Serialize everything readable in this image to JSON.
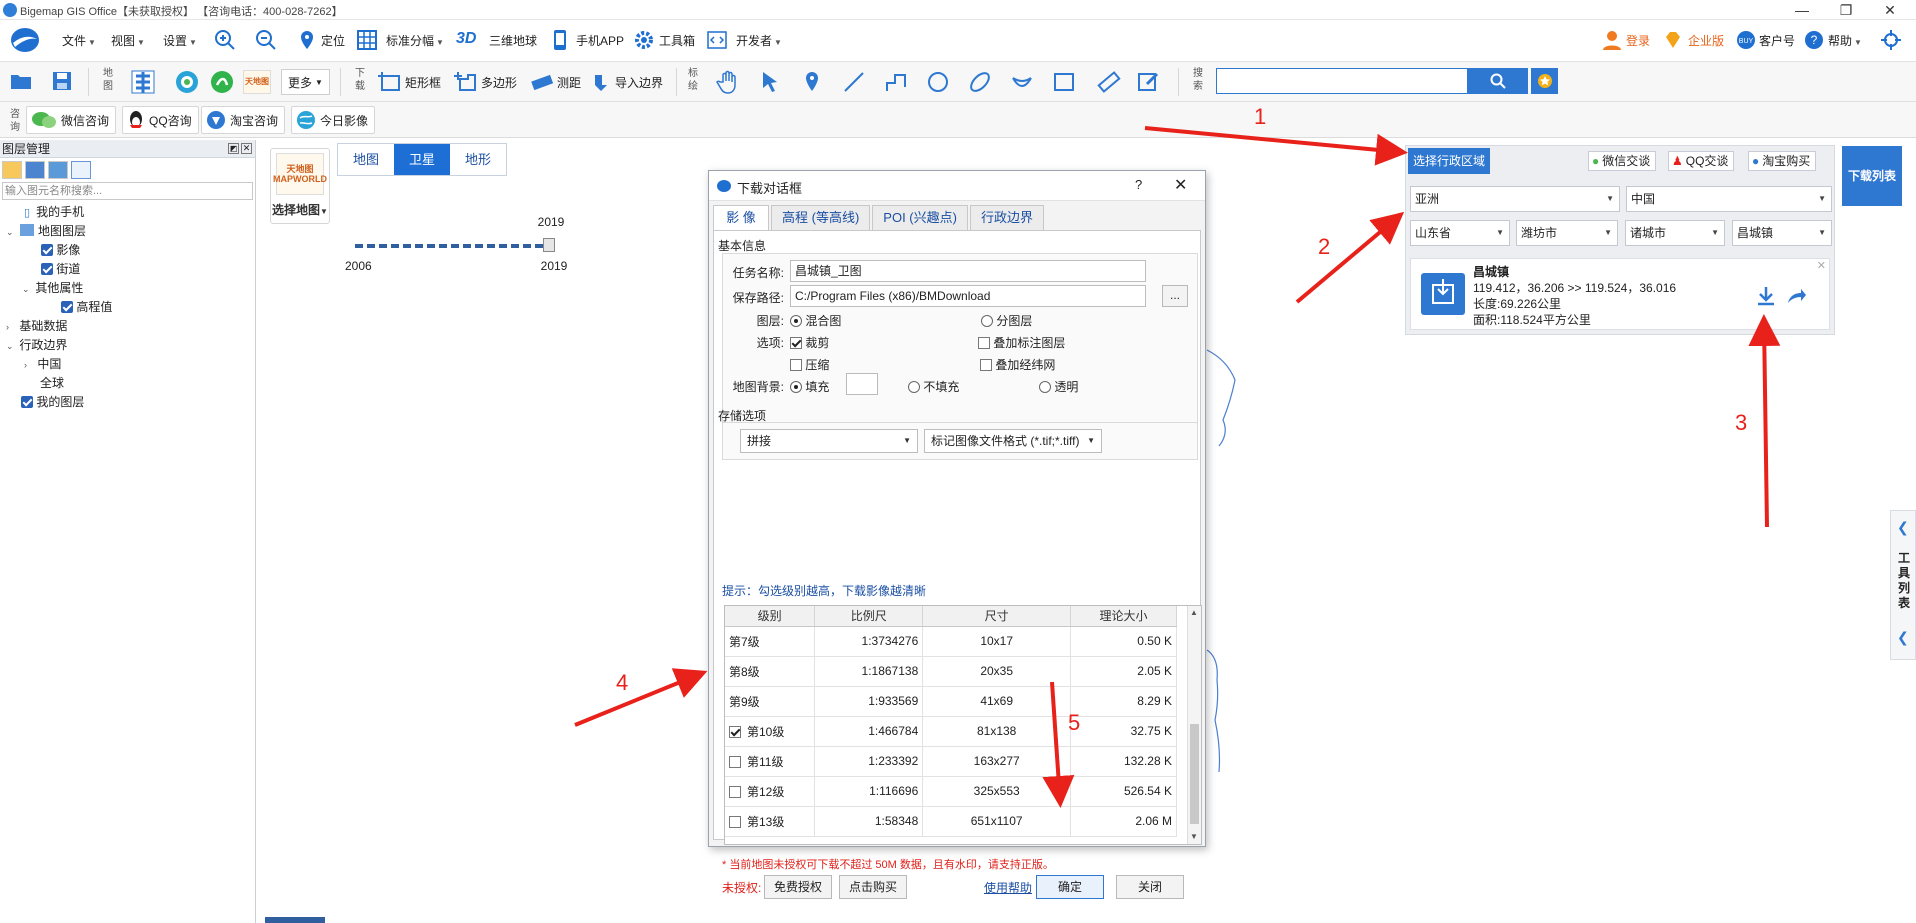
{
  "window": {
    "title": "Bigemap GIS Office【未获取授权】 【咨询电话：400-028-7262】"
  },
  "menu": {
    "file": "文件",
    "view": "视图",
    "settings": "设置",
    "locate": "定位",
    "tile_grid": "标准分幅",
    "globe_3d": "三维地球",
    "globe_3d_badge": "3D",
    "mobile_app": "手机APP",
    "toolbox": "工具箱",
    "developer": "开发者",
    "login": "登录",
    "enterprise": "企业版",
    "account": "客户号",
    "help": "帮助"
  },
  "toolbar": {
    "map_group_label": "地图",
    "more": "更多",
    "download_group_label": "下载",
    "rect": "矩形框",
    "polygon": "多边形",
    "measure": "测距",
    "import_boundary": "导入边界",
    "annotate_group_label": "标绘",
    "search_group_label": "搜索",
    "search_value": ""
  },
  "toolbar2": {
    "consult_label": "咨询",
    "wechat": "微信咨询",
    "qq": "QQ咨询",
    "taobao": "淘宝咨询",
    "today_imagery": "今日影像"
  },
  "layers_panel": {
    "title": "图层管理",
    "search_placeholder": "输入图元名称搜索...",
    "items": [
      {
        "label": "我的手机",
        "indent": 1
      },
      {
        "label": "地图图层",
        "indent": 0
      },
      {
        "label": "影像",
        "indent": 1
      },
      {
        "label": "街道",
        "indent": 1
      },
      {
        "label": "其他属性",
        "indent": 1
      },
      {
        "label": "高程值",
        "indent": 2
      },
      {
        "label": "基础数据",
        "indent": 0
      },
      {
        "label": "行政边界",
        "indent": 0
      },
      {
        "label": "中国",
        "indent": 1
      },
      {
        "label": "全球",
        "indent": 1
      },
      {
        "label": "我的图层",
        "indent": 0
      }
    ]
  },
  "map": {
    "select_map_thumb": "天地图 MAPWORLD",
    "select_map": "选择地图",
    "tabs": [
      "地图",
      "卫星",
      "地形"
    ],
    "active_tab": "卫星",
    "timeline": {
      "start": "2006",
      "end": "2019",
      "current": "2019",
      "position": 1.0
    }
  },
  "region_panel": {
    "tab": "选择行政区域",
    "wechat_chat": "微信交谈",
    "qq_chat": "QQ交谈",
    "taobao_buy": "淘宝购买",
    "continent": "亚洲",
    "country": "中国",
    "province": "山东省",
    "city": "潍坊市",
    "county": "诸城市",
    "town": "昌城镇",
    "result": {
      "name": "昌城镇",
      "bounds": "119.412，36.206 >> 119.524，36.016",
      "length": "长度:69.226公里",
      "area": "面积:118.524平方公里"
    }
  },
  "download_list_btn": "下载列表",
  "side_toolbar": "工具列表",
  "dialog": {
    "title": "下载对话框",
    "help": "?",
    "tabs": [
      "影 像",
      "高程 (等高线)",
      "POI (兴趣点)",
      "行政边界"
    ],
    "basic_info": "基本信息",
    "task_name_label": "任务名称:",
    "task_name": "昌城镇_卫图",
    "save_path_label": "保存路径:",
    "save_path": "C:/Program Files (x86)/BMDownload",
    "browse": "...",
    "layer_label": "图层:",
    "layer_merged": "混合图",
    "layer_split": "分图层",
    "options_label": "选项:",
    "opt_crop": "裁剪",
    "opt_overlay_labels": "叠加标注图层",
    "opt_compress": "压缩",
    "opt_overlay_grid": "叠加经纬网",
    "bg_label": "地图背景:",
    "bg_fill": "填充",
    "bg_nofill": "不填充",
    "bg_transparent": "透明",
    "storage_label": "存储选项",
    "storage_mode": "拼接",
    "storage_format": "标记图像文件格式 (*.tif;*.tiff)",
    "hint": "提示：勾选级别越高，下载影像越清晰",
    "columns": [
      "级别",
      "比例尺",
      "尺寸",
      "理论大小"
    ],
    "rows": [
      {
        "level": "第7级",
        "scale": "1:3734276",
        "size": "10x17",
        "est": "0.50 K",
        "check": "none"
      },
      {
        "level": "第8级",
        "scale": "1:1867138",
        "size": "20x35",
        "est": "2.05 K",
        "check": "none"
      },
      {
        "level": "第9级",
        "scale": "1:933569",
        "size": "41x69",
        "est": "8.29 K",
        "check": "none"
      },
      {
        "level": "第10级",
        "scale": "1:466784",
        "size": "81x138",
        "est": "32.75 K",
        "check": "on"
      },
      {
        "level": "第11级",
        "scale": "1:233392",
        "size": "163x277",
        "est": "132.28 K",
        "check": "off"
      },
      {
        "level": "第12级",
        "scale": "1:116696",
        "size": "325x553",
        "est": "526.54 K",
        "check": "off"
      },
      {
        "level": "第13级",
        "scale": "1:58348",
        "size": "651x1107",
        "est": "2.06 M",
        "check": "off"
      }
    ],
    "warning": "* 当前地图未授权可下载不超过 50M 数据，且有水印，请支持正版。",
    "unauthorized": "未授权:",
    "free_auth": "免费授权",
    "buy": "点击购买",
    "usage_help": "使用帮助",
    "ok": "确定",
    "close": "关闭"
  },
  "annotations": [
    "1",
    "2",
    "3",
    "4",
    "5"
  ],
  "colors": {
    "accent": "#2f78d1",
    "arrow": "#e8221a"
  }
}
